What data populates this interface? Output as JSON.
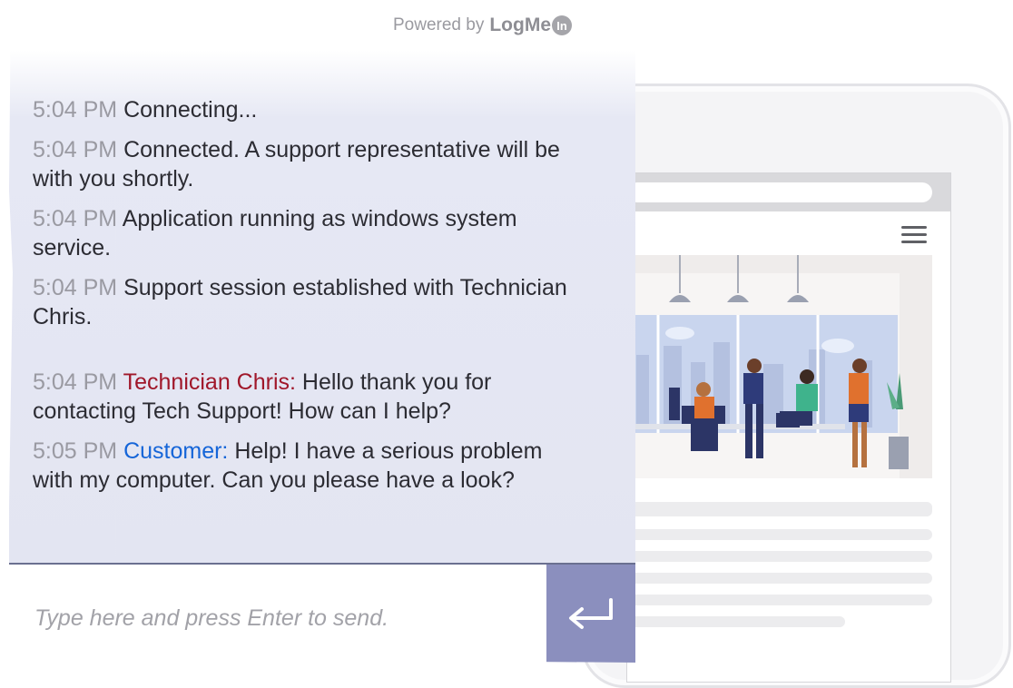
{
  "header": {
    "powered_by": "Powered by",
    "brand": "LogMe",
    "brand_badge": "In"
  },
  "messages": [
    {
      "time": "5:04 PM",
      "sender": "",
      "text": "Connecting..."
    },
    {
      "time": "5:04 PM",
      "sender": "",
      "text": "Connected. A support representative will be with you shortly."
    },
    {
      "time": "5:04 PM",
      "sender": "",
      "text": "Application running as windows system service."
    },
    {
      "time": "5:04 PM",
      "sender": "",
      "text": "Support session established with Technician Chris."
    },
    {
      "time": "5:04 PM",
      "sender": "Technician Chris:",
      "text": "Hello thank you for contacting Tech Support! How can I help?"
    },
    {
      "time": "5:05 PM",
      "sender": "Customer:",
      "text": "Help! I have a serious problem with my computer. Can you please have a look?"
    }
  ],
  "input": {
    "placeholder": "Type here and press Enter to send.",
    "value": ""
  },
  "icons": {
    "send": "enter-return-icon",
    "menu": "hamburger-menu-icon"
  },
  "colors": {
    "technician": "#a0172a",
    "customer": "#1565d8",
    "send_button": "#8b8fbe",
    "timestamp": "#9a9aa2"
  }
}
